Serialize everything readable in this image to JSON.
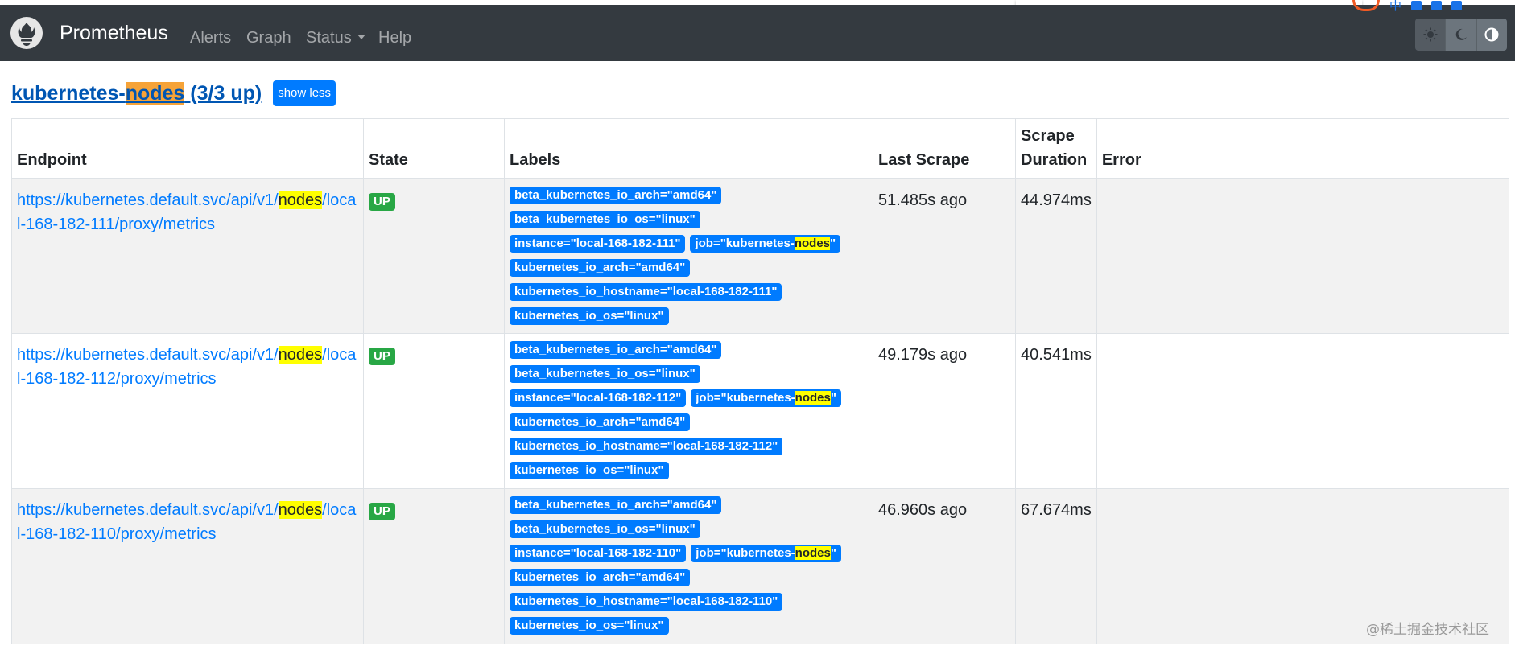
{
  "navbar": {
    "brand": "Prometheus",
    "links": [
      "Alerts",
      "Graph",
      "Status",
      "Help"
    ]
  },
  "system_tray": {
    "ime_label": "中"
  },
  "job": {
    "title_prefix": "kubernetes-",
    "title_match": "nodes",
    "title_suffix": " (3/3 up)",
    "toggle_label": "show less"
  },
  "table": {
    "headers": [
      "Endpoint",
      "State",
      "Labels",
      "Last Scrape",
      "Scrape Duration",
      "Error"
    ],
    "rows": [
      {
        "endpoint_prefix": "https://kubernetes.default.svc/api/v1/",
        "endpoint_match": "nodes",
        "endpoint_suffix": "/local-168-182-111/proxy/metrics",
        "state": "UP",
        "labels": {
          "beta_arch": "beta_kubernetes_io_arch=\"amd64\"",
          "beta_os": "beta_kubernetes_io_os=\"linux\"",
          "instance": "instance=\"local-168-182-111\"",
          "job_prefix": "job=\"kubernetes-",
          "job_match": "nodes",
          "job_suffix": "\"",
          "arch": "kubernetes_io_arch=\"amd64\"",
          "hostname": "kubernetes_io_hostname=\"local-168-182-111\"",
          "os": "kubernetes_io_os=\"linux\""
        },
        "last_scrape": "51.485s ago",
        "scrape_duration": "44.974ms",
        "error": ""
      },
      {
        "endpoint_prefix": "https://kubernetes.default.svc/api/v1/",
        "endpoint_match": "nodes",
        "endpoint_suffix": "/local-168-182-112/proxy/metrics",
        "state": "UP",
        "labels": {
          "beta_arch": "beta_kubernetes_io_arch=\"amd64\"",
          "beta_os": "beta_kubernetes_io_os=\"linux\"",
          "instance": "instance=\"local-168-182-112\"",
          "job_prefix": "job=\"kubernetes-",
          "job_match": "nodes",
          "job_suffix": "\"",
          "arch": "kubernetes_io_arch=\"amd64\"",
          "hostname": "kubernetes_io_hostname=\"local-168-182-112\"",
          "os": "kubernetes_io_os=\"linux\""
        },
        "last_scrape": "49.179s ago",
        "scrape_duration": "40.541ms",
        "error": ""
      },
      {
        "endpoint_prefix": "https://kubernetes.default.svc/api/v1/",
        "endpoint_match": "nodes",
        "endpoint_suffix": "/local-168-182-110/proxy/metrics",
        "state": "UP",
        "labels": {
          "beta_arch": "beta_kubernetes_io_arch=\"amd64\"",
          "beta_os": "beta_kubernetes_io_os=\"linux\"",
          "instance": "instance=\"local-168-182-110\"",
          "job_prefix": "job=\"kubernetes-",
          "job_match": "nodes",
          "job_suffix": "\"",
          "arch": "kubernetes_io_arch=\"amd64\"",
          "hostname": "kubernetes_io_hostname=\"local-168-182-110\"",
          "os": "kubernetes_io_os=\"linux\""
        },
        "last_scrape": "46.960s ago",
        "scrape_duration": "67.674ms",
        "error": ""
      }
    ]
  },
  "watermark": "@稀土掘金技术社区",
  "colors": {
    "navbar_bg": "#343a40",
    "link": "#007bff",
    "badge_up": "#28a745",
    "search_highlight": "#ffff00",
    "title_highlight": "#f6a338"
  }
}
